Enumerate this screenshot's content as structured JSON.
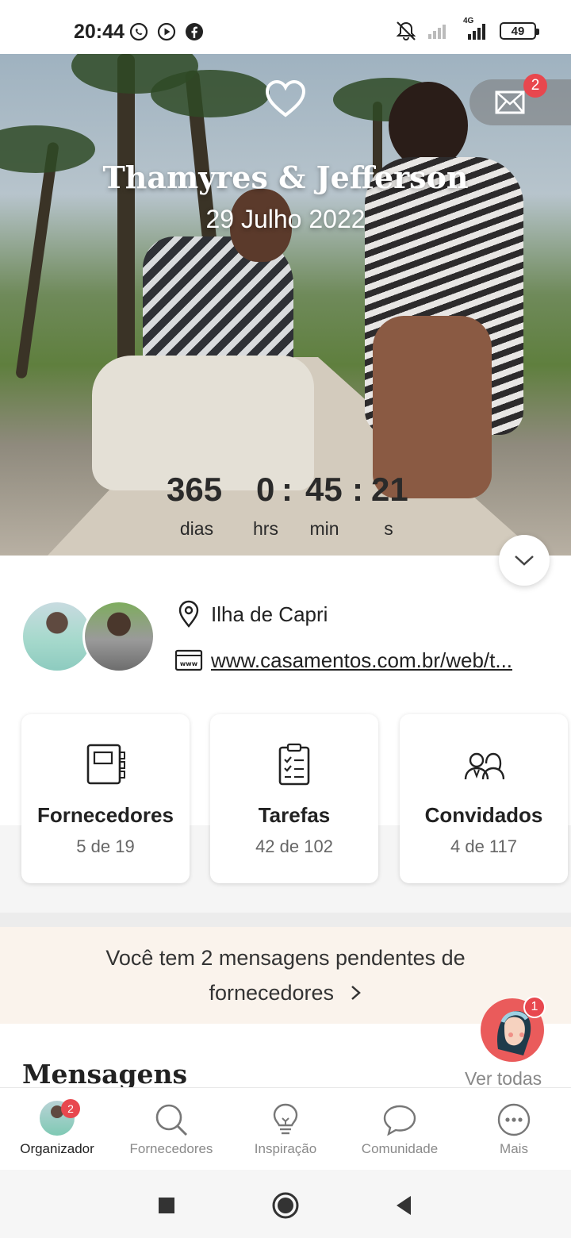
{
  "status_bar": {
    "time": "20:44",
    "app_icons": [
      "whatsapp-icon",
      "play-icon",
      "facebook-icon"
    ],
    "network": "4G",
    "battery": "49"
  },
  "hero": {
    "couple_names": "Thamyres & Jefferson",
    "wedding_date": "29 Julho 2022",
    "mail_badge": "2",
    "countdown": {
      "days": "365",
      "hours": "0",
      "minutes": "45",
      "seconds": "21",
      "days_label": "dias",
      "hours_label": "hrs",
      "minutes_label": "min",
      "seconds_label": "s",
      "separator": ":"
    }
  },
  "info": {
    "location": "Ilha de Capri",
    "website": "www.casamentos.com.br/web/t..."
  },
  "cards": [
    {
      "title": "Fornecedores",
      "subtitle": "5 de 19",
      "icon": "notebook-icon"
    },
    {
      "title": "Tarefas",
      "subtitle": "42 de 102",
      "icon": "clipboard-checklist-icon"
    },
    {
      "title": "Convidados",
      "subtitle": "4 de 117",
      "icon": "guests-icon"
    }
  ],
  "pending": {
    "line1": "Você tem 2 mensagens pendentes de",
    "line2": "fornecedores",
    "helper_badge": "1"
  },
  "messages_section": {
    "title": "Mensagens",
    "see_all": "Ver todas"
  },
  "bottom_nav": [
    {
      "label": "Organizador",
      "badge": "2",
      "active": true
    },
    {
      "label": "Fornecedores"
    },
    {
      "label": "Inspiração"
    },
    {
      "label": "Comunidade"
    },
    {
      "label": "Mais"
    }
  ],
  "colors": {
    "accent": "#e8474e",
    "pending_bg": "#faf3ec"
  }
}
